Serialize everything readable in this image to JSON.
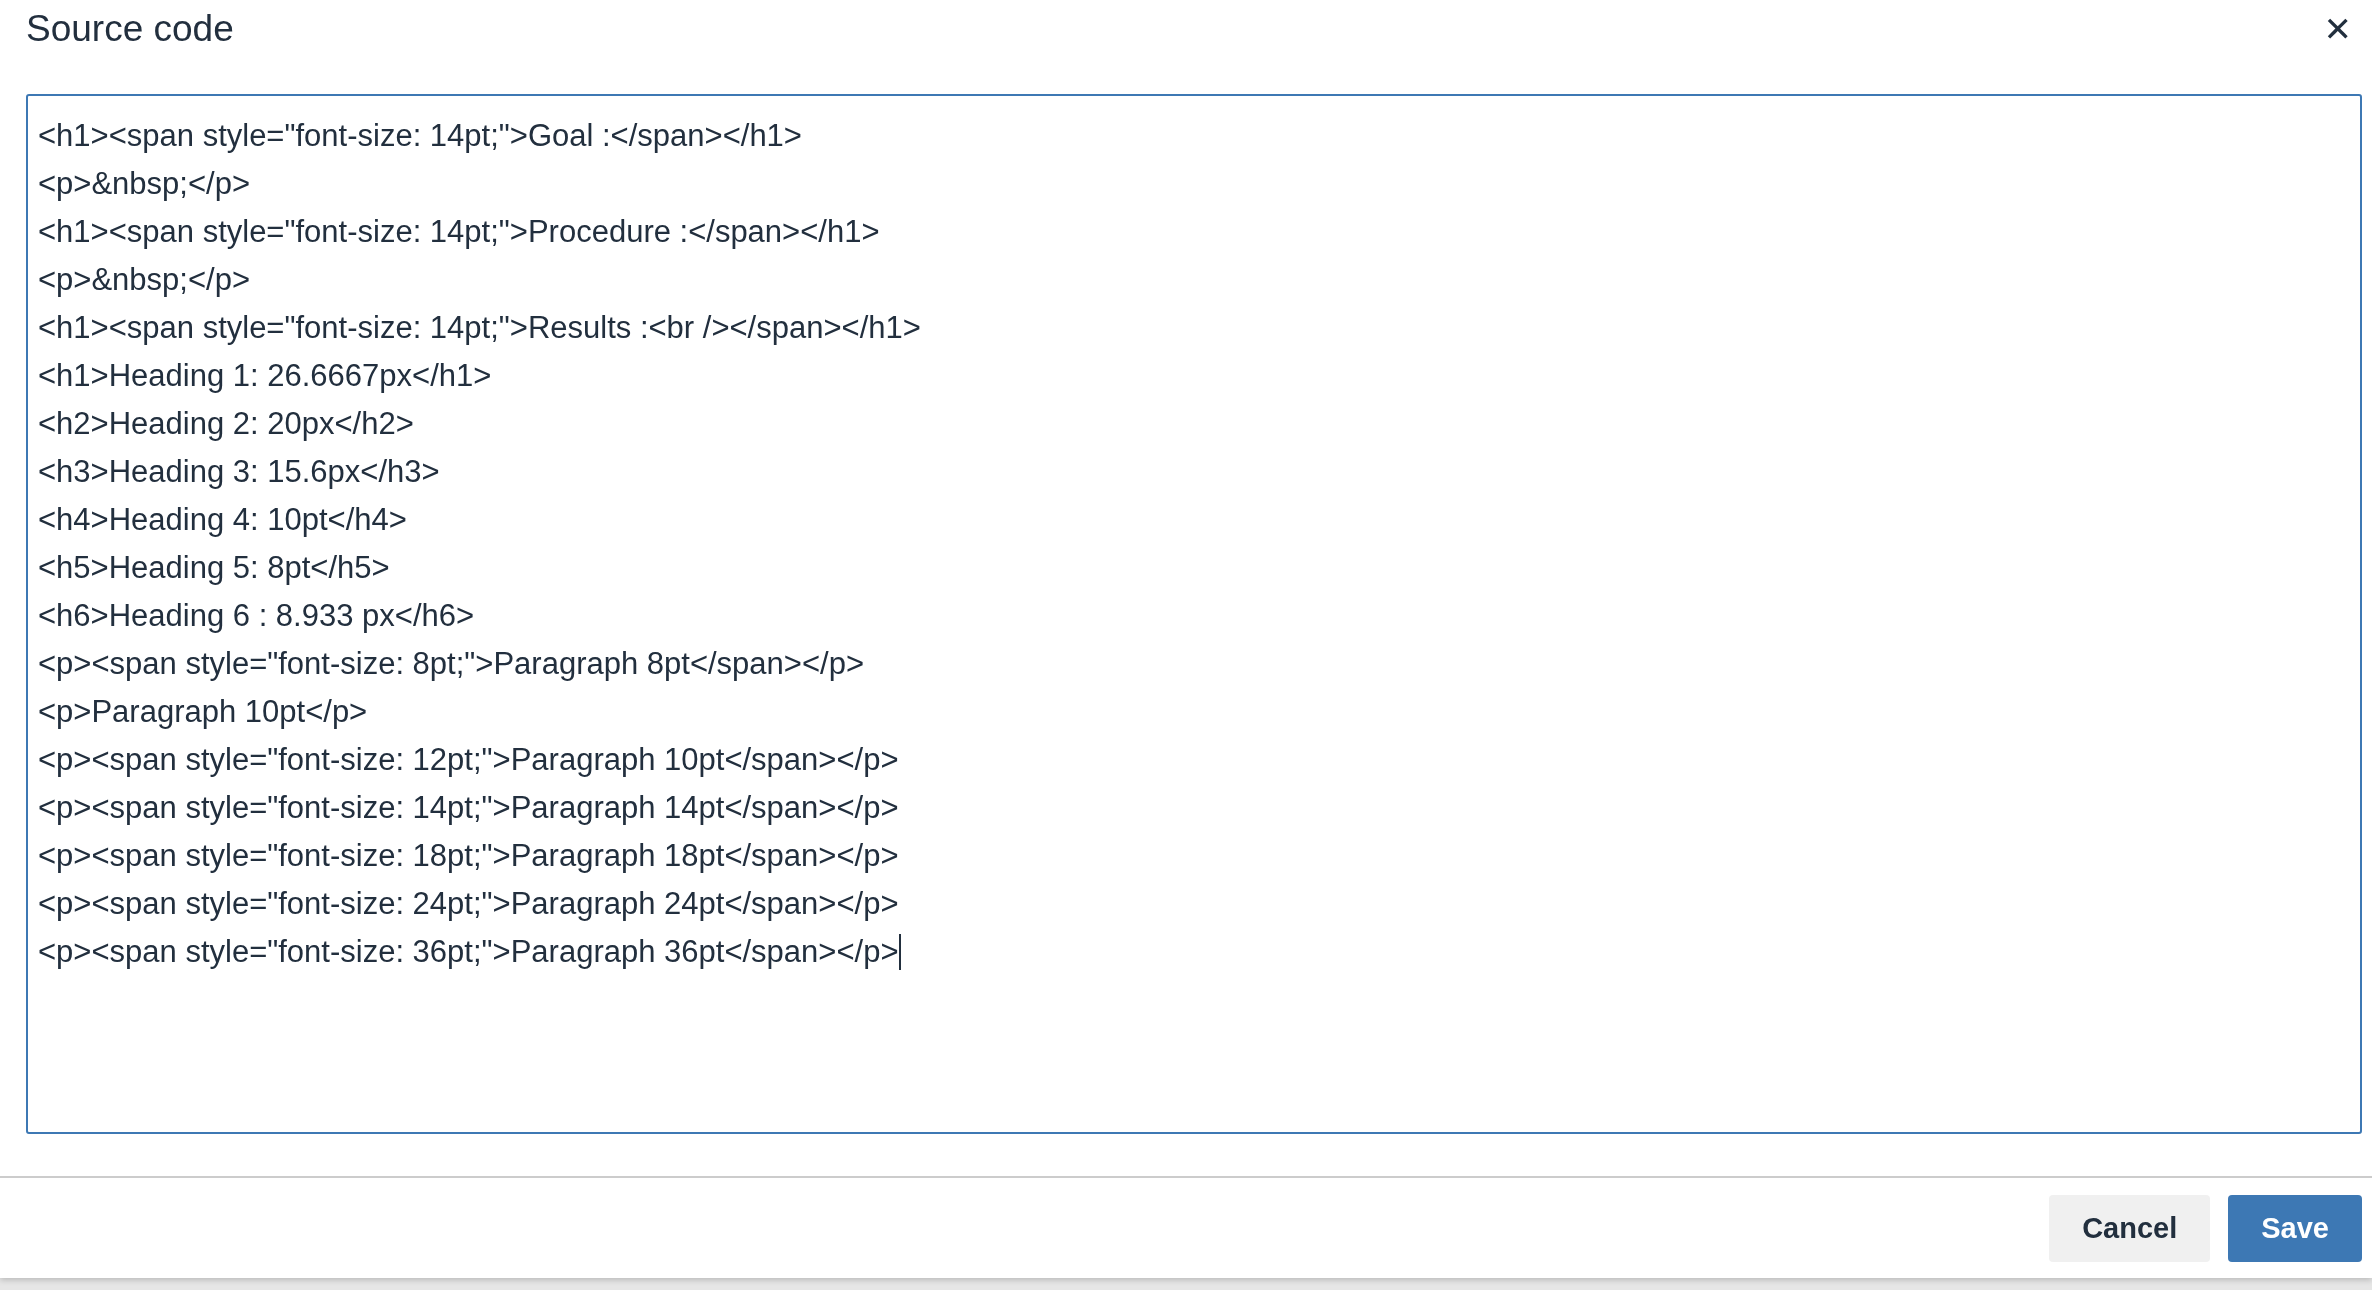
{
  "dialog": {
    "title": "Source code",
    "close": "✕"
  },
  "editor": {
    "lines": [
      "<h1><span style=\"font-size: 14pt;\">Goal :</span></h1>",
      "<p>&nbsp;</p>",
      "<h1><span style=\"font-size: 14pt;\">Procedure :</span></h1>",
      "<p>&nbsp;</p>",
      "<h1><span style=\"font-size: 14pt;\">Results :<br /></span></h1>",
      "<h1>Heading 1: 26.6667px</h1>",
      "<h2>Heading 2: 20px</h2>",
      "<h3>Heading 3: 15.6px</h3>",
      "<h4>Heading 4: 10pt</h4>",
      "<h5>Heading 5: 8pt</h5>",
      "<h6>Heading 6 : 8.933 px</h6>",
      "<p><span style=\"font-size: 8pt;\">Paragraph 8pt</span></p>",
      "<p>Paragraph 10pt</p>",
      "<p><span style=\"font-size: 12pt;\">Paragraph 10pt</span></p>",
      "<p><span style=\"font-size: 14pt;\">Paragraph 14pt</span></p>",
      "<p><span style=\"font-size: 18pt;\">Paragraph 18pt</span></p>",
      "<p><span style=\"font-size: 24pt;\">Paragraph 24pt</span></p>",
      "<p><span style=\"font-size: 36pt;\">Paragraph 36pt</span></p>"
    ]
  },
  "buttons": [
    {
      "label": "Cancel",
      "kind": "secondary"
    },
    {
      "label": "Save",
      "kind": "primary"
    }
  ]
}
